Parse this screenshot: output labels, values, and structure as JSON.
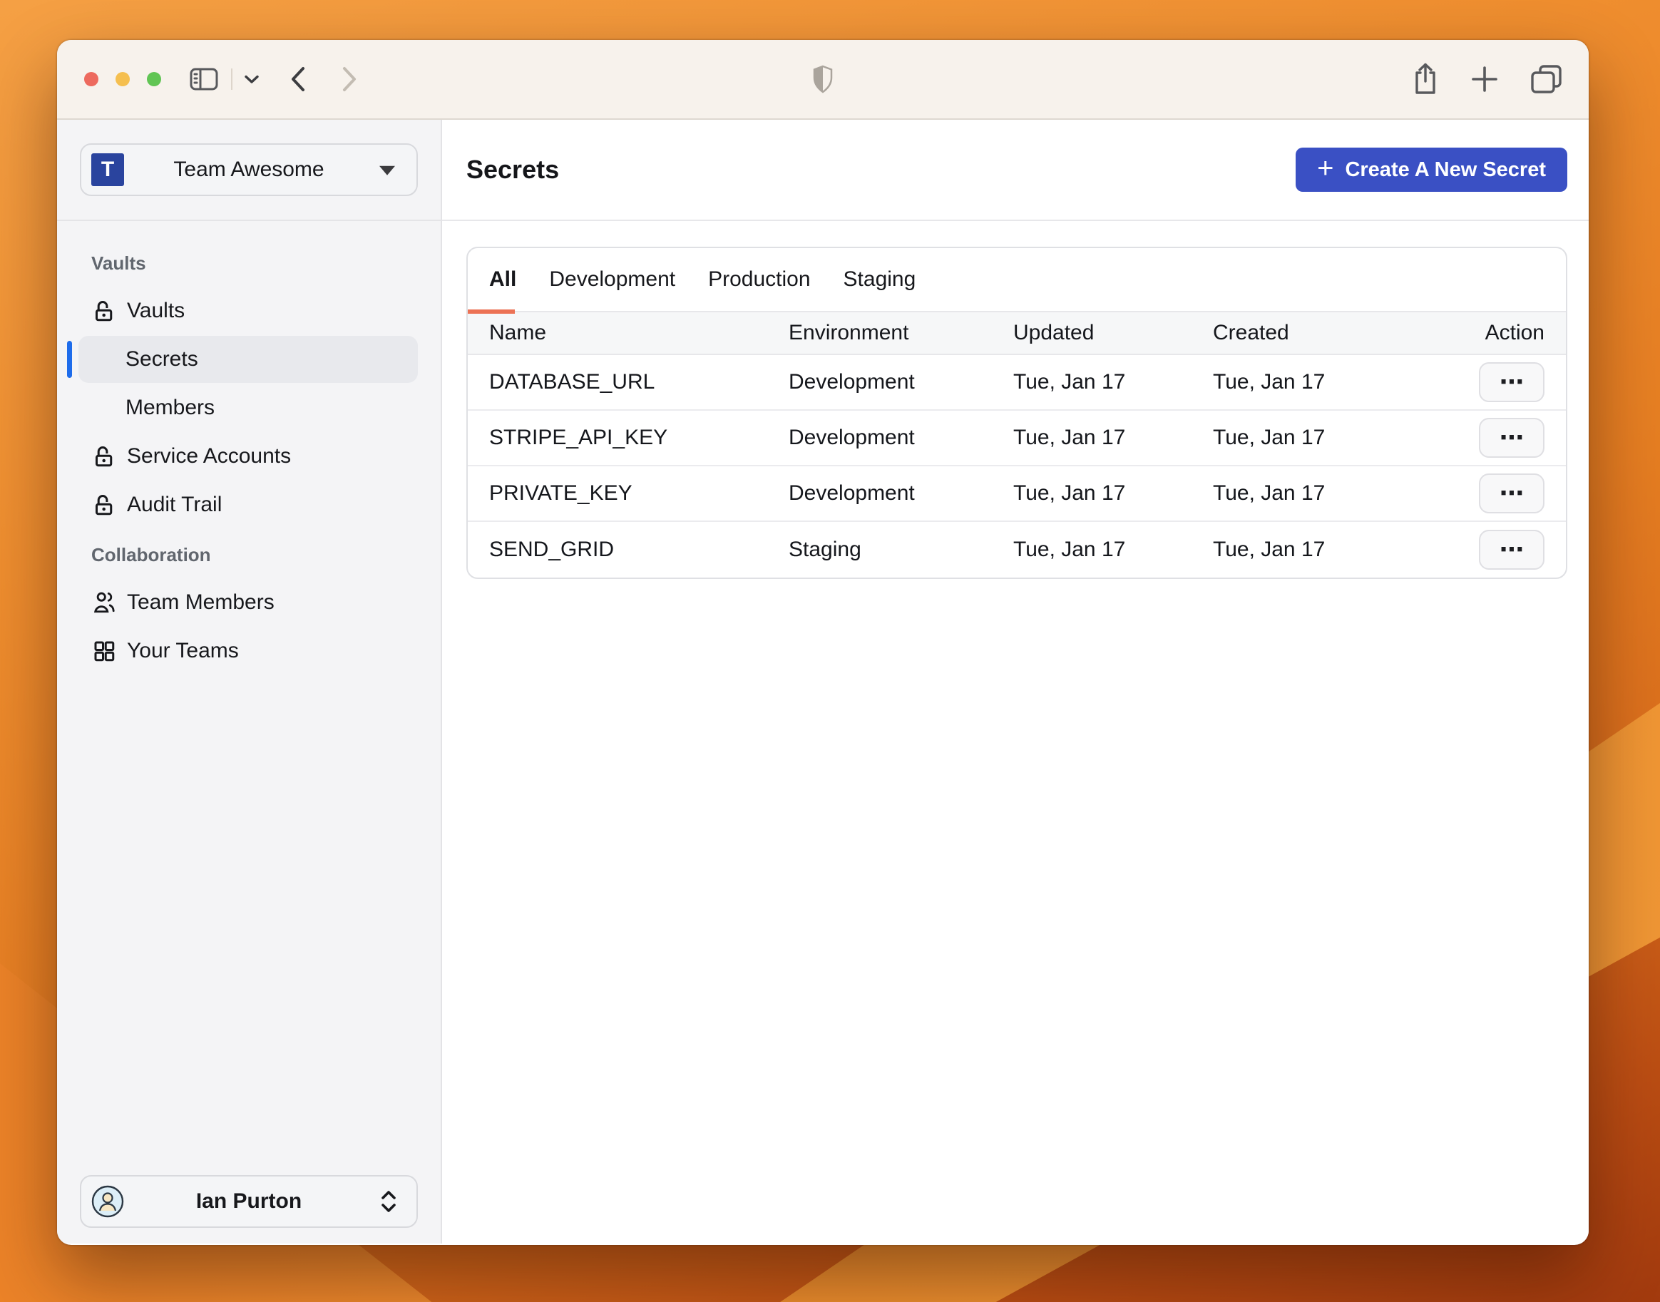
{
  "toolbar": {
    "traffic_lights": [
      "close",
      "minimize",
      "zoom"
    ],
    "icons": [
      "sidebar-toggle",
      "chevron-down",
      "back",
      "forward",
      "shield",
      "share",
      "new-tab",
      "tab-overview"
    ]
  },
  "sidebar": {
    "team_selector": {
      "avatar_letter": "T",
      "name": "Team Awesome"
    },
    "sections": [
      {
        "label": "Vaults",
        "items": [
          {
            "label": "Vaults",
            "icon": "lock-open-icon",
            "indent": false,
            "selected": false
          },
          {
            "label": "Secrets",
            "icon": null,
            "indent": true,
            "selected": true
          },
          {
            "label": "Members",
            "icon": null,
            "indent": true,
            "selected": false
          },
          {
            "label": "Service Accounts",
            "icon": "lock-open-icon",
            "indent": false,
            "selected": false
          },
          {
            "label": "Audit Trail",
            "icon": "lock-open-icon",
            "indent": false,
            "selected": false
          }
        ]
      },
      {
        "label": "Collaboration",
        "items": [
          {
            "label": "Team Members",
            "icon": "users-icon",
            "indent": false,
            "selected": false
          },
          {
            "label": "Your Teams",
            "icon": "grid-icon",
            "indent": false,
            "selected": false
          }
        ]
      }
    ],
    "user_selector": {
      "name": "Ian Purton"
    }
  },
  "main": {
    "title": "Secrets",
    "create_button": {
      "plus": "+",
      "label": "Create A New Secret"
    },
    "tabs": [
      {
        "label": "All",
        "active": true
      },
      {
        "label": "Development",
        "active": false
      },
      {
        "label": "Production",
        "active": false
      },
      {
        "label": "Staging",
        "active": false
      }
    ],
    "table": {
      "columns": [
        "Name",
        "Environment",
        "Updated",
        "Created",
        "Action"
      ],
      "rows": [
        {
          "name": "DATABASE_URL",
          "environment": "Development",
          "updated": "Tue, Jan 17",
          "created": "Tue, Jan 17"
        },
        {
          "name": "STRIPE_API_KEY",
          "environment": "Development",
          "updated": "Tue, Jan 17",
          "created": "Tue, Jan 17"
        },
        {
          "name": "PRIVATE_KEY",
          "environment": "Development",
          "updated": "Tue, Jan 17",
          "created": "Tue, Jan 17"
        },
        {
          "name": "SEND_GRID",
          "environment": "Staging",
          "updated": "Tue, Jan 17",
          "created": "Tue, Jan 17"
        }
      ],
      "action_button_label": "⋯"
    }
  },
  "colors": {
    "accent_blue": "#3a50c4",
    "selected_indicator_blue": "#1e6ceb",
    "tab_underline_orange": "#ec7255",
    "team_avatar_blue": "#2a449e"
  }
}
